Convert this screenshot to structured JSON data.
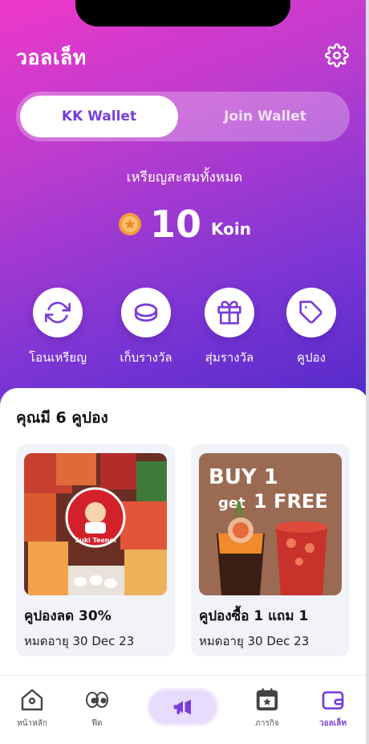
{
  "header": {
    "title": "วอลเล็ท"
  },
  "wallet_tabs": {
    "active": "KK Wallet",
    "inactive": "Join Wallet"
  },
  "balance": {
    "label": "เหรียญสะสมทั้งหมด",
    "value": "10",
    "unit": "Koin"
  },
  "actions": [
    {
      "label": "โอนเหรียญ",
      "icon": "refresh-icon"
    },
    {
      "label": "เก็บรางวัล",
      "icon": "coin-icon"
    },
    {
      "label": "สุ่มรางวัล",
      "icon": "gift-icon"
    },
    {
      "label": "คูปอง",
      "icon": "tag-icon"
    }
  ],
  "coupons": {
    "heading": "คุณมี 6 คูปอง",
    "items": [
      {
        "name": "คูปองลด 30%",
        "expiry": "หมดอายุ 30 Dec 23",
        "logo_text": "Suki Teenoi"
      },
      {
        "name": "คูปองซื้อ 1 แถม 1",
        "expiry": "หมดอายุ 30 Dec 23",
        "promo_line1": "BUY 1",
        "promo_line2_a": "get",
        "promo_line2_b": "1 FREE"
      }
    ]
  },
  "bottom_nav": [
    {
      "label": "หน้าหลัก",
      "icon": "home-icon"
    },
    {
      "label": "ฟีด",
      "icon": "eyes-icon"
    },
    {
      "label": "",
      "icon": "megaphone-icon"
    },
    {
      "label": "ภารกิจ",
      "icon": "calendar-star-icon"
    },
    {
      "label": "วอลเล็ท",
      "icon": "wallet-icon",
      "active": true
    }
  ],
  "colors": {
    "accent": "#7a3ed8",
    "gradient_start": "#ee38c9",
    "gradient_end": "#4f2ac9"
  }
}
